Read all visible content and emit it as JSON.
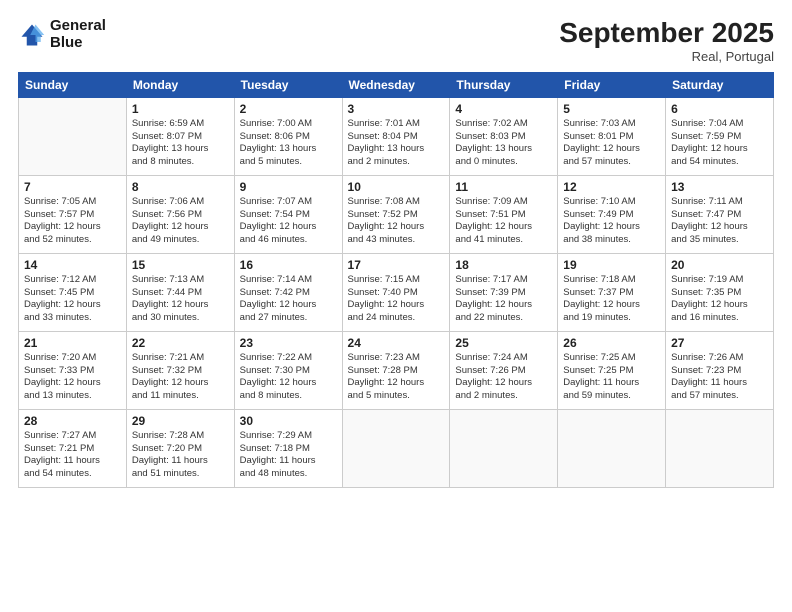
{
  "logo": {
    "line1": "General",
    "line2": "Blue"
  },
  "title": "September 2025",
  "location": "Real, Portugal",
  "days_header": [
    "Sunday",
    "Monday",
    "Tuesday",
    "Wednesday",
    "Thursday",
    "Friday",
    "Saturday"
  ],
  "weeks": [
    [
      {
        "day": "",
        "info": ""
      },
      {
        "day": "1",
        "info": "Sunrise: 6:59 AM\nSunset: 8:07 PM\nDaylight: 13 hours\nand 8 minutes."
      },
      {
        "day": "2",
        "info": "Sunrise: 7:00 AM\nSunset: 8:06 PM\nDaylight: 13 hours\nand 5 minutes."
      },
      {
        "day": "3",
        "info": "Sunrise: 7:01 AM\nSunset: 8:04 PM\nDaylight: 13 hours\nand 2 minutes."
      },
      {
        "day": "4",
        "info": "Sunrise: 7:02 AM\nSunset: 8:03 PM\nDaylight: 13 hours\nand 0 minutes."
      },
      {
        "day": "5",
        "info": "Sunrise: 7:03 AM\nSunset: 8:01 PM\nDaylight: 12 hours\nand 57 minutes."
      },
      {
        "day": "6",
        "info": "Sunrise: 7:04 AM\nSunset: 7:59 PM\nDaylight: 12 hours\nand 54 minutes."
      }
    ],
    [
      {
        "day": "7",
        "info": "Sunrise: 7:05 AM\nSunset: 7:57 PM\nDaylight: 12 hours\nand 52 minutes."
      },
      {
        "day": "8",
        "info": "Sunrise: 7:06 AM\nSunset: 7:56 PM\nDaylight: 12 hours\nand 49 minutes."
      },
      {
        "day": "9",
        "info": "Sunrise: 7:07 AM\nSunset: 7:54 PM\nDaylight: 12 hours\nand 46 minutes."
      },
      {
        "day": "10",
        "info": "Sunrise: 7:08 AM\nSunset: 7:52 PM\nDaylight: 12 hours\nand 43 minutes."
      },
      {
        "day": "11",
        "info": "Sunrise: 7:09 AM\nSunset: 7:51 PM\nDaylight: 12 hours\nand 41 minutes."
      },
      {
        "day": "12",
        "info": "Sunrise: 7:10 AM\nSunset: 7:49 PM\nDaylight: 12 hours\nand 38 minutes."
      },
      {
        "day": "13",
        "info": "Sunrise: 7:11 AM\nSunset: 7:47 PM\nDaylight: 12 hours\nand 35 minutes."
      }
    ],
    [
      {
        "day": "14",
        "info": "Sunrise: 7:12 AM\nSunset: 7:45 PM\nDaylight: 12 hours\nand 33 minutes."
      },
      {
        "day": "15",
        "info": "Sunrise: 7:13 AM\nSunset: 7:44 PM\nDaylight: 12 hours\nand 30 minutes."
      },
      {
        "day": "16",
        "info": "Sunrise: 7:14 AM\nSunset: 7:42 PM\nDaylight: 12 hours\nand 27 minutes."
      },
      {
        "day": "17",
        "info": "Sunrise: 7:15 AM\nSunset: 7:40 PM\nDaylight: 12 hours\nand 24 minutes."
      },
      {
        "day": "18",
        "info": "Sunrise: 7:17 AM\nSunset: 7:39 PM\nDaylight: 12 hours\nand 22 minutes."
      },
      {
        "day": "19",
        "info": "Sunrise: 7:18 AM\nSunset: 7:37 PM\nDaylight: 12 hours\nand 19 minutes."
      },
      {
        "day": "20",
        "info": "Sunrise: 7:19 AM\nSunset: 7:35 PM\nDaylight: 12 hours\nand 16 minutes."
      }
    ],
    [
      {
        "day": "21",
        "info": "Sunrise: 7:20 AM\nSunset: 7:33 PM\nDaylight: 12 hours\nand 13 minutes."
      },
      {
        "day": "22",
        "info": "Sunrise: 7:21 AM\nSunset: 7:32 PM\nDaylight: 12 hours\nand 11 minutes."
      },
      {
        "day": "23",
        "info": "Sunrise: 7:22 AM\nSunset: 7:30 PM\nDaylight: 12 hours\nand 8 minutes."
      },
      {
        "day": "24",
        "info": "Sunrise: 7:23 AM\nSunset: 7:28 PM\nDaylight: 12 hours\nand 5 minutes."
      },
      {
        "day": "25",
        "info": "Sunrise: 7:24 AM\nSunset: 7:26 PM\nDaylight: 12 hours\nand 2 minutes."
      },
      {
        "day": "26",
        "info": "Sunrise: 7:25 AM\nSunset: 7:25 PM\nDaylight: 11 hours\nand 59 minutes."
      },
      {
        "day": "27",
        "info": "Sunrise: 7:26 AM\nSunset: 7:23 PM\nDaylight: 11 hours\nand 57 minutes."
      }
    ],
    [
      {
        "day": "28",
        "info": "Sunrise: 7:27 AM\nSunset: 7:21 PM\nDaylight: 11 hours\nand 54 minutes."
      },
      {
        "day": "29",
        "info": "Sunrise: 7:28 AM\nSunset: 7:20 PM\nDaylight: 11 hours\nand 51 minutes."
      },
      {
        "day": "30",
        "info": "Sunrise: 7:29 AM\nSunset: 7:18 PM\nDaylight: 11 hours\nand 48 minutes."
      },
      {
        "day": "",
        "info": ""
      },
      {
        "day": "",
        "info": ""
      },
      {
        "day": "",
        "info": ""
      },
      {
        "day": "",
        "info": ""
      }
    ]
  ]
}
